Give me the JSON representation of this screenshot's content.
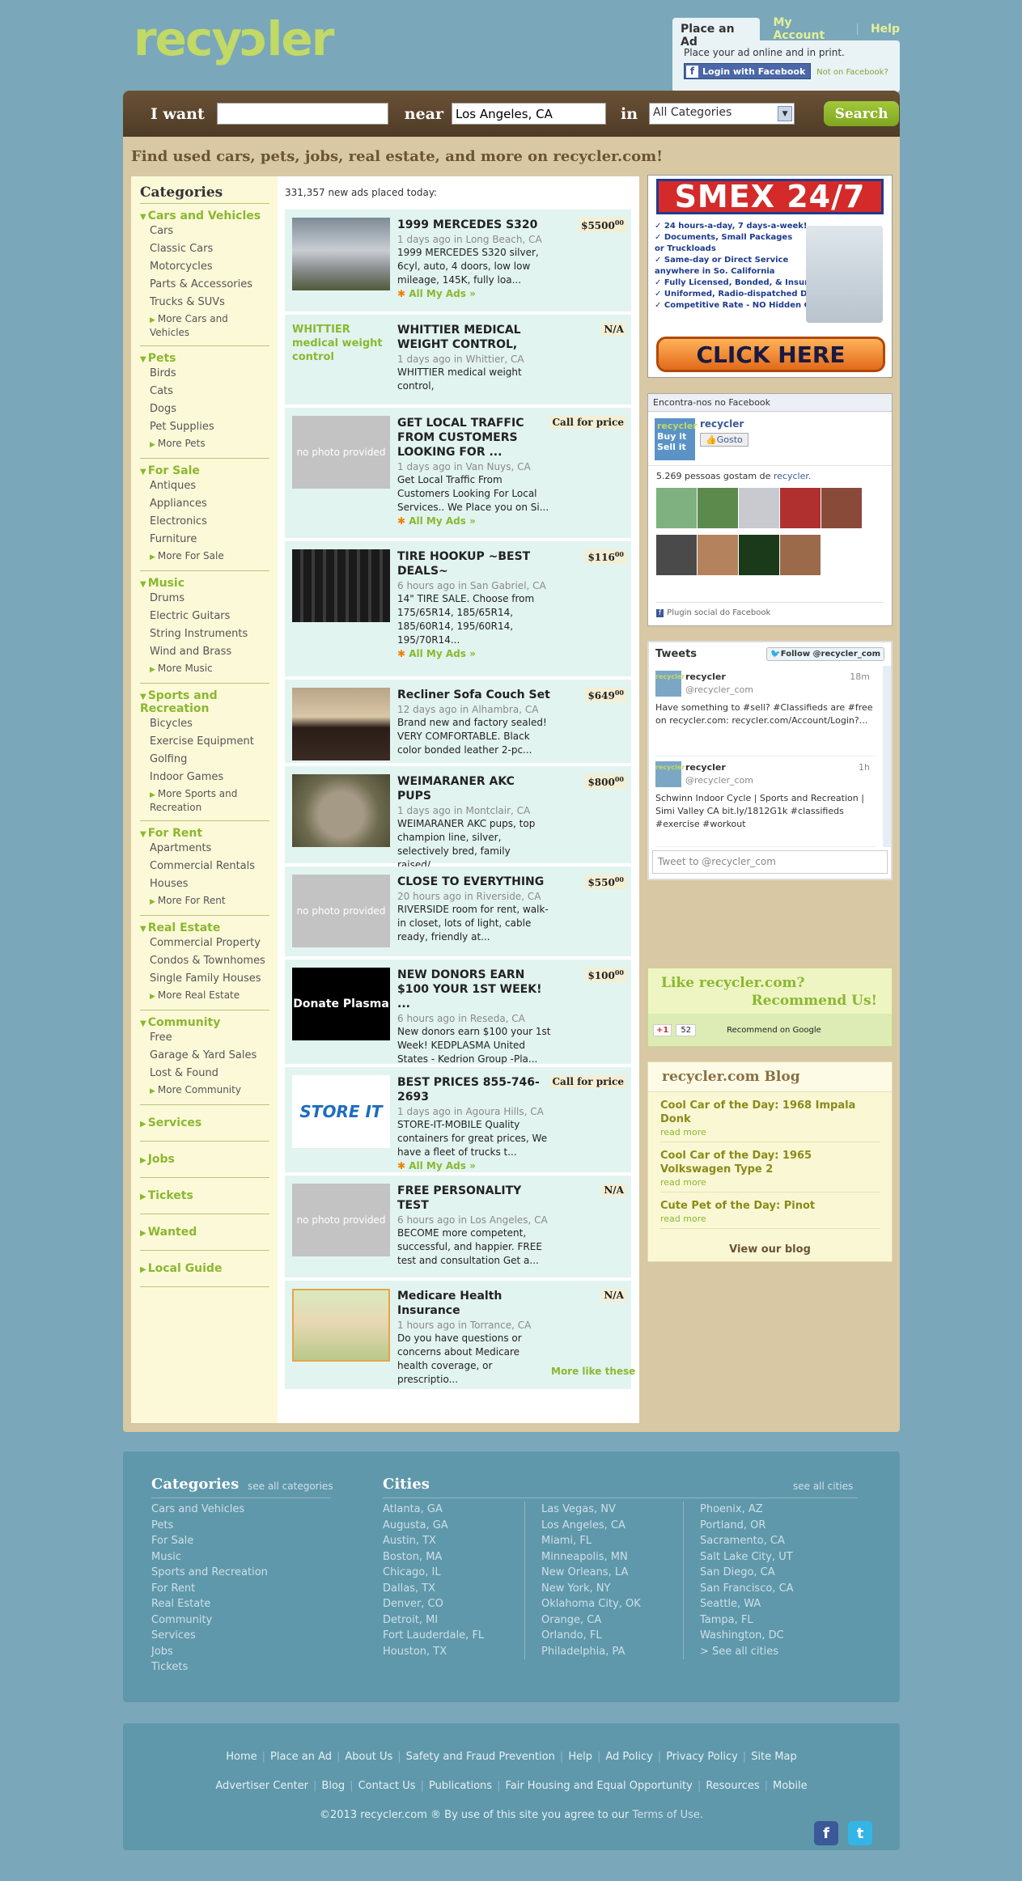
{
  "logo": "recycler",
  "top": {
    "tab_place_ad": "Place an Ad",
    "my_account": "My Account",
    "help": "Help",
    "promo": "Place your ad online and in print.",
    "fb_login": "Login with Facebook",
    "not_fb": "Not on Facebook?"
  },
  "search": {
    "i_want": "I want",
    "near": "near",
    "location": "Los Angeles, CA",
    "in": "in",
    "category": "All Categories",
    "button": "Search"
  },
  "tagline": "Find used cars, pets, jobs, real estate, and more on recycler.com!",
  "sidebar": {
    "title": "Categories",
    "groups": [
      {
        "name": "Cars and Vehicles",
        "items": [
          "Cars",
          "Classic Cars",
          "Motorcycles",
          "Parts & Accessories",
          "Trucks & SUVs"
        ],
        "more": "More Cars and Vehicles"
      },
      {
        "name": "Pets",
        "items": [
          "Birds",
          "Cats",
          "Dogs",
          "Pet Supplies"
        ],
        "more": "More Pets"
      },
      {
        "name": "For Sale",
        "items": [
          "Antiques",
          "Appliances",
          "Electronics",
          "Furniture"
        ],
        "more": "More For Sale"
      },
      {
        "name": "Music",
        "items": [
          "Drums",
          "Electric Guitars",
          "String Instruments",
          "Wind and Brass"
        ],
        "more": "More Music"
      },
      {
        "name": "Sports and Recreation",
        "items": [
          "Bicycles",
          "Exercise Equipment",
          "Golfing",
          "Indoor Games"
        ],
        "more": "More Sports and Recreation"
      },
      {
        "name": "For Rent",
        "items": [
          "Apartments",
          "Commercial Rentals",
          "Houses"
        ],
        "more": "More For Rent"
      },
      {
        "name": "Real Estate",
        "items": [
          "Commercial Property",
          "Condos & Townhomes",
          "Single Family Houses"
        ],
        "more": "More Real Estate"
      },
      {
        "name": "Community",
        "items": [
          "Free",
          "Garage & Yard Sales",
          "Lost & Found"
        ],
        "more": "More Community"
      }
    ],
    "collapsed": [
      "Services",
      "Jobs",
      "Tickets",
      "Wanted",
      "Local Guide"
    ]
  },
  "feed": {
    "header": "331,357 new ads placed today:",
    "my_ads": "All My Ads »",
    "no_photo": "no photo provided",
    "more_like": "More like these",
    "ads": [
      {
        "title": "1999 MERCEDES S320",
        "meta": "1 days ago in Long Beach, CA",
        "desc": "1999 MERCEDES S320 silver, 6cyl, auto, 4 doors, low low mileage, 145K, fully loa...",
        "price": "$5500",
        "cents": "00",
        "photo": "car",
        "mine": true
      },
      {
        "title": "WHITTIER MEDICAL WEIGHT CONTROL,",
        "meta": "1 days ago in Whittier, CA",
        "desc": "WHITTIER medical weight control,",
        "price": "N/A",
        "photo": "text",
        "photo_text": "WHITTIER medical weight control",
        "mine": false
      },
      {
        "title": "GET LOCAL TRAFFIC FROM CUSTOMERS LOOKING FOR ...",
        "meta": "1 days ago in Van Nuys, CA",
        "desc": "Get Local Traffic From Customers Looking For Local Services.. We Place you on Si...",
        "price": "Call for price",
        "photo": "none",
        "mine": true
      },
      {
        "title": "TIRE HOOKUP ~BEST DEALS~",
        "meta": "6 hours ago in San Gabriel, CA",
        "desc": "14\" TIRE SALE. Choose from 175/65R14, 185/65R14, 185/60R14, 195/60R14, 195/70R14...",
        "price": "$116",
        "cents": "00",
        "photo": "tires",
        "mine": true
      },
      {
        "title": "Recliner Sofa Couch Set",
        "meta": "12 days ago in Alhambra, CA",
        "desc": "Brand new and factory sealed! VERY COMFORTABLE. Black color bonded leather 2-pc...",
        "price": "$649",
        "cents": "00",
        "photo": "sofa",
        "mine": false
      },
      {
        "title": "WEIMARANER AKC PUPS",
        "meta": "1 days ago in Montclair, CA",
        "desc": "WEIMARANER AKC pups, top champion line, silver, selectively bred, family raised/...",
        "price": "$800",
        "cents": "00",
        "photo": "pups",
        "mine": true
      },
      {
        "title": "CLOSE TO EVERYTHING",
        "meta": "20 hours ago in Riverside, CA",
        "desc": "RIVERSIDE room for rent, walk-in closet, lots of light, cable ready, friendly at...",
        "price": "$550",
        "cents": "00",
        "photo": "none",
        "mine": false
      },
      {
        "title": "NEW DONORS EARN $100 YOUR 1ST WEEK! ...",
        "meta": "6 hours ago in Reseda, CA",
        "desc": "New donors earn $100 your 1st Week! KEDPLASMA United States - Kedrion Group -Pla...",
        "price": "$100",
        "cents": "00",
        "photo": "plasma",
        "photo_text": "Donate Plasma",
        "mine": true
      },
      {
        "title": "BEST PRICES 855-746-2693",
        "meta": "1 days ago in Agoura Hills, CA",
        "desc": "STORE-IT-MOBILE Quality containers for great prices, We have a fleet of trucks t...",
        "price": "Call for price",
        "photo": "storeit",
        "photo_text": "STORE IT",
        "mine": true
      },
      {
        "title": "FREE PERSONALITY TEST",
        "meta": "6 hours ago in Los Angeles, CA",
        "desc": "BECOME more competent, successful, and happier. FREE test and consultation Get a...",
        "price": "N/A",
        "photo": "none",
        "mine": false
      },
      {
        "title": "Medicare Health Insurance",
        "meta": "1 hours ago in Torrance, CA",
        "desc": "Do you have questions or concerns about Medicare health coverage, or prescriptio...",
        "price": "N/A",
        "photo": "couple",
        "mine": false
      }
    ]
  },
  "smex": {
    "title": "SMEX 24/7",
    "lines": [
      "✓ 24 hours-a-day, 7 days-a-week!",
      "✓ Documents, Small Packages",
      "   or Truckloads",
      "✓ Same-day or Direct Service",
      "   anywhere in So. California",
      "✓ Fully Licensed, Bonded, & Insured",
      "✓ Uniformed, Radio-dispatched Drivers",
      "✓ Competitive Rate - NO Hidden Charges!"
    ],
    "click": "CLICK HERE"
  },
  "facebook": {
    "header": "Encontra-nos no Facebook",
    "page": "recycler",
    "like": "Gosto",
    "count": "5.269 pessoas gostam de",
    "count_link": "recycler.",
    "plugin": "Plugin social do Facebook"
  },
  "twitter": {
    "title": "Tweets",
    "follow": "Follow @recycler_com",
    "tweets": [
      {
        "name": "recycler",
        "handle": "@recycler_com",
        "time": "18m",
        "text": "Have something to #sell? #Classifieds are #free on recycler.com: recycler.com/Account/Login?..."
      },
      {
        "name": "recycler",
        "handle": "@recycler_com",
        "time": "1h",
        "text": "Schwinn Indoor Cycle | Sports and Recreation | Simi Valley CA bit.ly/1812G1k #classifieds #exercise #workout"
      }
    ],
    "placeholder": "Tweet to @recycler_com"
  },
  "like": {
    "line1": "Like recycler.com?",
    "line2": "Recommend Us!",
    "gplus": "+1",
    "gcount": "52",
    "rec": "Recommend on Google"
  },
  "blog": {
    "title": "recycler.com Blog",
    "read_more": "read more",
    "posts": [
      "Cool Car of the Day: 1968 Impala Donk",
      "Cool Car of the Day: 1965 Volkswagen Type 2",
      "Cute Pet of the Day: Pinot"
    ],
    "view": "View our blog"
  },
  "footer": {
    "categories_title": "Categories",
    "see_all_categories": "see all categories",
    "categories": [
      "Cars and Vehicles",
      "Pets",
      "For Sale",
      "Music",
      "Sports and Recreation",
      "For Rent",
      "Real Estate",
      "Community",
      "Services",
      "Jobs",
      "Tickets"
    ],
    "cities_title": "Cities",
    "see_all_cities": "see all cities",
    "cities_col1": [
      "Atlanta, GA",
      "Augusta, GA",
      "Austin, TX",
      "Boston, MA",
      "Chicago, IL",
      "Dallas, TX",
      "Denver, CO",
      "Detroit, MI",
      "Fort Lauderdale, FL",
      "Houston, TX"
    ],
    "cities_col2": [
      "Las Vegas, NV",
      "Los Angeles, CA",
      "Miami, FL",
      "Minneapolis, MN",
      "New Orleans, LA",
      "New York, NY",
      "Oklahoma City, OK",
      "Orange, CA",
      "Orlando, FL",
      "Philadelphia, PA"
    ],
    "cities_col3": [
      "Phoenix, AZ",
      "Portland, OR",
      "Sacramento, CA",
      "Salt Lake City, UT",
      "San Diego, CA",
      "San Francisco, CA",
      "Seattle, WA",
      "Tampa, FL",
      "Washington, DC",
      "> See all cities"
    ],
    "links1": [
      "Home",
      "Place an Ad",
      "About Us",
      "Safety and Fraud Prevention",
      "Help",
      "Ad Policy",
      "Privacy Policy",
      "Site Map"
    ],
    "links2": [
      "Advertiser Center",
      "Blog",
      "Contact Us",
      "Publications",
      "Fair Housing and Equal Opportunity",
      "Resources",
      "Mobile"
    ],
    "copyright": "©2013 recycler.com ® By use of this site you agree to our",
    "terms": "Terms of Use."
  }
}
